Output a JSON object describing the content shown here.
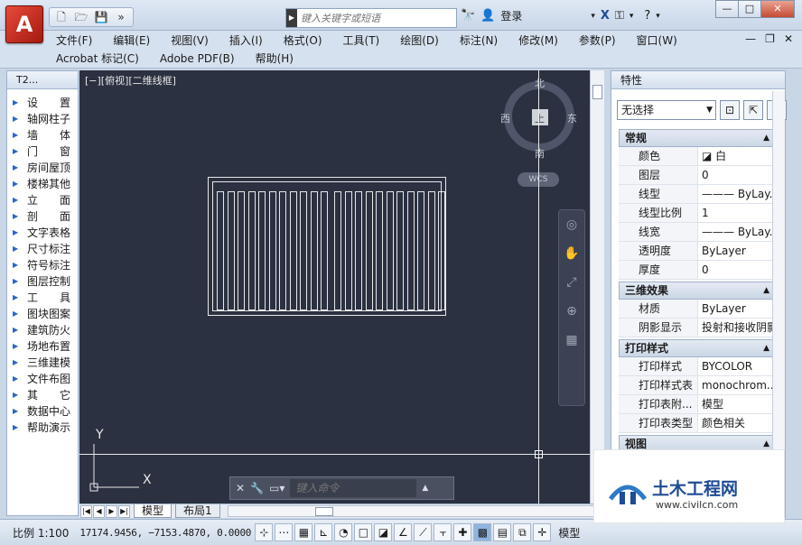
{
  "titlebar": {
    "search_placeholder": "键入关键字或短语",
    "login_label": "登录",
    "window_buttons": [
      "—",
      "□",
      "✕"
    ]
  },
  "menus": {
    "row1": [
      "文件(F)",
      "编辑(E)",
      "视图(V)",
      "插入(I)",
      "格式(O)",
      "工具(T)",
      "绘图(D)",
      "标注(N)",
      "修改(M)",
      "参数(P)",
      "窗口(W)"
    ],
    "row2": [
      "Acrobat 标记(C)",
      "Adobe PDF(B)",
      "帮助(H)"
    ]
  },
  "left_panel": {
    "title": "T2...",
    "items": [
      "设　　置",
      "轴网柱子",
      "墙　　体",
      "门　　窗",
      "房间屋顶",
      "楼梯其他",
      "立　　面",
      "剖　　面",
      "文字表格",
      "尺寸标注",
      "符号标注",
      "图层控制",
      "工　　具",
      "图块图案",
      "建筑防火",
      "场地布置",
      "三维建模",
      "文件布图",
      "其　　它",
      "数据中心",
      "帮助演示"
    ]
  },
  "canvas": {
    "view_label": "[−][俯视][二维线框]",
    "compass": {
      "north": "北",
      "south": "南",
      "east": "东",
      "west": "西",
      "center": "上"
    },
    "wcs_label": "WCS",
    "ucs_y": "Y",
    "ucs_x": "X",
    "command_placeholder": "键入命令"
  },
  "tabs": {
    "model": "模型",
    "layout": "布局1"
  },
  "statusbar": {
    "scale": "比例 1:100",
    "coords": "17174.9456, −7153.4870, 0.0000",
    "model_label": "模型"
  },
  "properties": {
    "title": "特性",
    "selection": "无选择",
    "sections": [
      {
        "name": "常规",
        "rows": [
          {
            "name": "颜色",
            "value": "◪ 白"
          },
          {
            "name": "图层",
            "value": "0"
          },
          {
            "name": "线型",
            "value": "——— ByLay..."
          },
          {
            "name": "线型比例",
            "value": "1"
          },
          {
            "name": "线宽",
            "value": "——— ByLay..."
          },
          {
            "name": "透明度",
            "value": "ByLayer"
          },
          {
            "name": "厚度",
            "value": "0"
          }
        ]
      },
      {
        "name": "三维效果",
        "rows": [
          {
            "name": "材质",
            "value": "ByLayer"
          },
          {
            "name": "阴影显示",
            "value": "投射和接收阴影"
          }
        ]
      },
      {
        "name": "打印样式",
        "rows": [
          {
            "name": "打印样式",
            "value": "BYCOLOR"
          },
          {
            "name": "打印样式表",
            "value": "monochrom..."
          },
          {
            "name": "打印表附...",
            "value": "模型"
          },
          {
            "name": "打印表类型",
            "value": "颜色相关"
          }
        ]
      },
      {
        "name": "视图",
        "rows": []
      }
    ]
  },
  "watermark": {
    "title": "土木工程网",
    "url": "www.civilcn.com"
  },
  "colors": {
    "canvas_bg": "#2b3141",
    "accent": "#c0271a",
    "watermark_blue": "#1e4c95"
  }
}
